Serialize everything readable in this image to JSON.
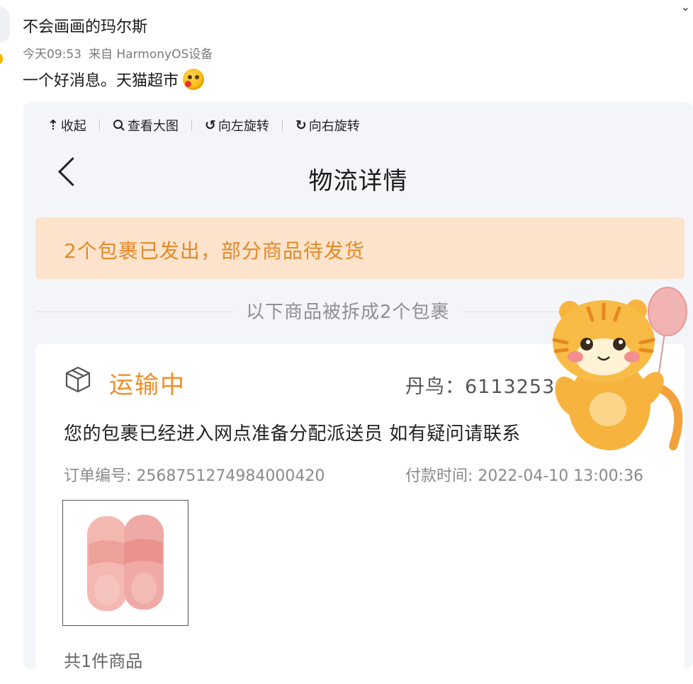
{
  "post": {
    "user_name": "不会画画的玛尔斯",
    "time": "今天09:53",
    "source": "来自 HarmonyOS设备",
    "text": "一个好消息。天猫超市"
  },
  "toolbar": {
    "collapse": "收起",
    "view_large": "查看大图",
    "rotate_left": "向左旋转",
    "rotate_right": "向右旋转"
  },
  "screen": {
    "title": "物流详情",
    "notice": "2个包裹已发出，部分商品待发货",
    "split_label": "以下商品被拆成2个包裹"
  },
  "package": {
    "status": "运输中",
    "courier": "丹鸟：6113253",
    "tracking_message": "您的包裹已经进入网点准备分配派送员 如有疑问请联系",
    "order_number": "订单编号: 2568751274984000420",
    "payment_time": "付款时间: 2022-04-10 13:00:36",
    "item_count": "共1件商品"
  },
  "colors": {
    "accent_orange": "#ef8f2a",
    "notice_bg": "#fde3cc",
    "verify_badge": "#f5b400"
  },
  "icons": [
    "verified-icon",
    "upload-icon",
    "search-icon",
    "rotate-left-icon",
    "rotate-right-icon",
    "back-icon",
    "package-box-icon"
  ]
}
